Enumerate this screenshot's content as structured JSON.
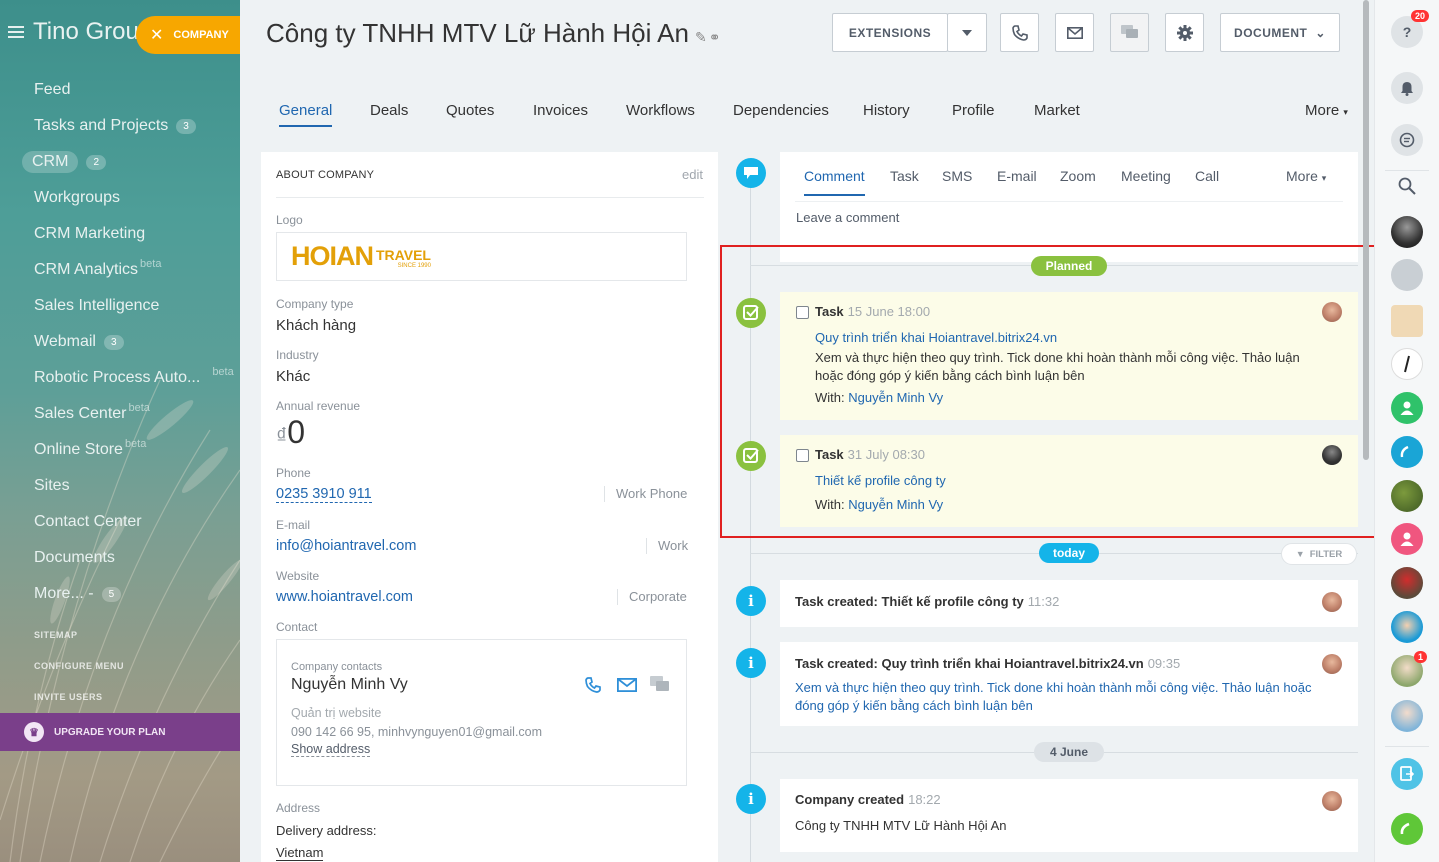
{
  "sidebar": {
    "portal_title": "Tino Grou",
    "company_button": "COMPANY",
    "items": [
      {
        "label": "Feed"
      },
      {
        "label": "Tasks and Projects",
        "counter": "3"
      },
      {
        "label": "CRM",
        "counter": "2"
      },
      {
        "label": "Workgroups"
      },
      {
        "label": "CRM Marketing"
      },
      {
        "label": "CRM Analytics",
        "beta": "beta"
      },
      {
        "label": "Sales Intelligence"
      },
      {
        "label": "Webmail",
        "counter": "3"
      },
      {
        "label": "Robotic Process Auto...",
        "beta": "beta"
      },
      {
        "label": "Sales Center",
        "beta": "beta"
      },
      {
        "label": "Online Store",
        "beta": "beta"
      },
      {
        "label": "Sites"
      },
      {
        "label": "Contact Center"
      },
      {
        "label": "Documents"
      },
      {
        "label": "More... -",
        "counter": "5"
      }
    ],
    "sitemap": "SITEMAP",
    "configure": "CONFIGURE MENU",
    "invite": "INVITE USERS",
    "upgrade": "UPGRADE YOUR PLAN"
  },
  "header": {
    "title": "Công ty TNHH MTV Lữ Hành Hội  An",
    "extensions": "EXTENSIONS",
    "document": "DOCUMENT"
  },
  "tabs": [
    "General",
    "Deals",
    "Quotes",
    "Invoices",
    "Workflows",
    "Dependencies",
    "History",
    "Profile",
    "Market",
    "More"
  ],
  "about": {
    "heading": "ABOUT COMPANY",
    "edit": "edit",
    "logo_label": "Logo",
    "logo_text": "HOIAN",
    "logo_travel": "TRAVEL",
    "logo_since": "SINCE 1990",
    "type_label": "Company type",
    "type_value": "Khách hàng",
    "industry_label": "Industry",
    "industry_value": "Khác",
    "revenue_label": "Annual revenue",
    "revenue_currency": "₫",
    "revenue_value": "0",
    "phone_label": "Phone",
    "phone_value": "0235 3910 911",
    "phone_tag": "Work Phone",
    "email_label": "E-mail",
    "email_value": "info@hoiantravel.com",
    "email_tag": "Work",
    "website_label": "Website",
    "website_value": "www.hoiantravel.com",
    "website_tag": "Corporate",
    "contact_label": "Contact",
    "contact_section": "Company contacts",
    "contact_name": "Nguyễn Minh Vy",
    "contact_role": "Quản trị website",
    "contact_details": "090 142 66 95, minhvynguyen01@gmail.com",
    "show_address": "Show address",
    "address_label": "Address",
    "delivery_label": "Delivery address:",
    "country": "Vietnam"
  },
  "timeline": {
    "editor_tabs": [
      "Comment",
      "Task",
      "SMS",
      "E-mail",
      "Zoom",
      "Meeting",
      "Call",
      "More"
    ],
    "comment_placeholder": "Leave a comment",
    "planned": "Planned",
    "today": "today",
    "filter": "FILTER",
    "date_divider": "4 June",
    "tasks": [
      {
        "type": "Task",
        "time": "15 June 18:00",
        "title": "Quy trình triển khai Hoiantravel.bitrix24.vn",
        "desc": "Xem và thực hiện theo quy trình. Tick done khi hoàn thành mỗi công việc. Thảo luận hoặc đóng góp ý kiến bằng cách bình luận bên",
        "with_label": "With:",
        "with": "Nguyễn Minh Vy"
      },
      {
        "type": "Task",
        "time": "31 July 08:30",
        "title": "Thiết kế profile công ty",
        "with_label": "With:",
        "with": "Nguyễn Minh Vy"
      }
    ],
    "history": [
      {
        "title": "Task created: Thiết kế profile công ty",
        "time": "11:32"
      },
      {
        "title": "Task created: Quy trình triển khai Hoiantravel.bitrix24.vn",
        "time": "09:35",
        "desc": "Xem và thực hiện theo quy trình. Tick done khi hoàn thành mỗi công việc. Thảo luận hoặc đóng góp ý kiến bằng cách bình luận bên"
      },
      {
        "title": "Company created",
        "time": "18:22",
        "desc": "Công ty TNHH MTV Lữ Hành Hội An"
      }
    ]
  },
  "rightbar": {
    "help_badge": "20",
    "chat_badge": "1"
  },
  "colors": {
    "accent": "#2067b0",
    "orange": "#f7a700",
    "green": "#8ac13f",
    "cyan": "#14b4e9",
    "highlight": "#e02020"
  }
}
